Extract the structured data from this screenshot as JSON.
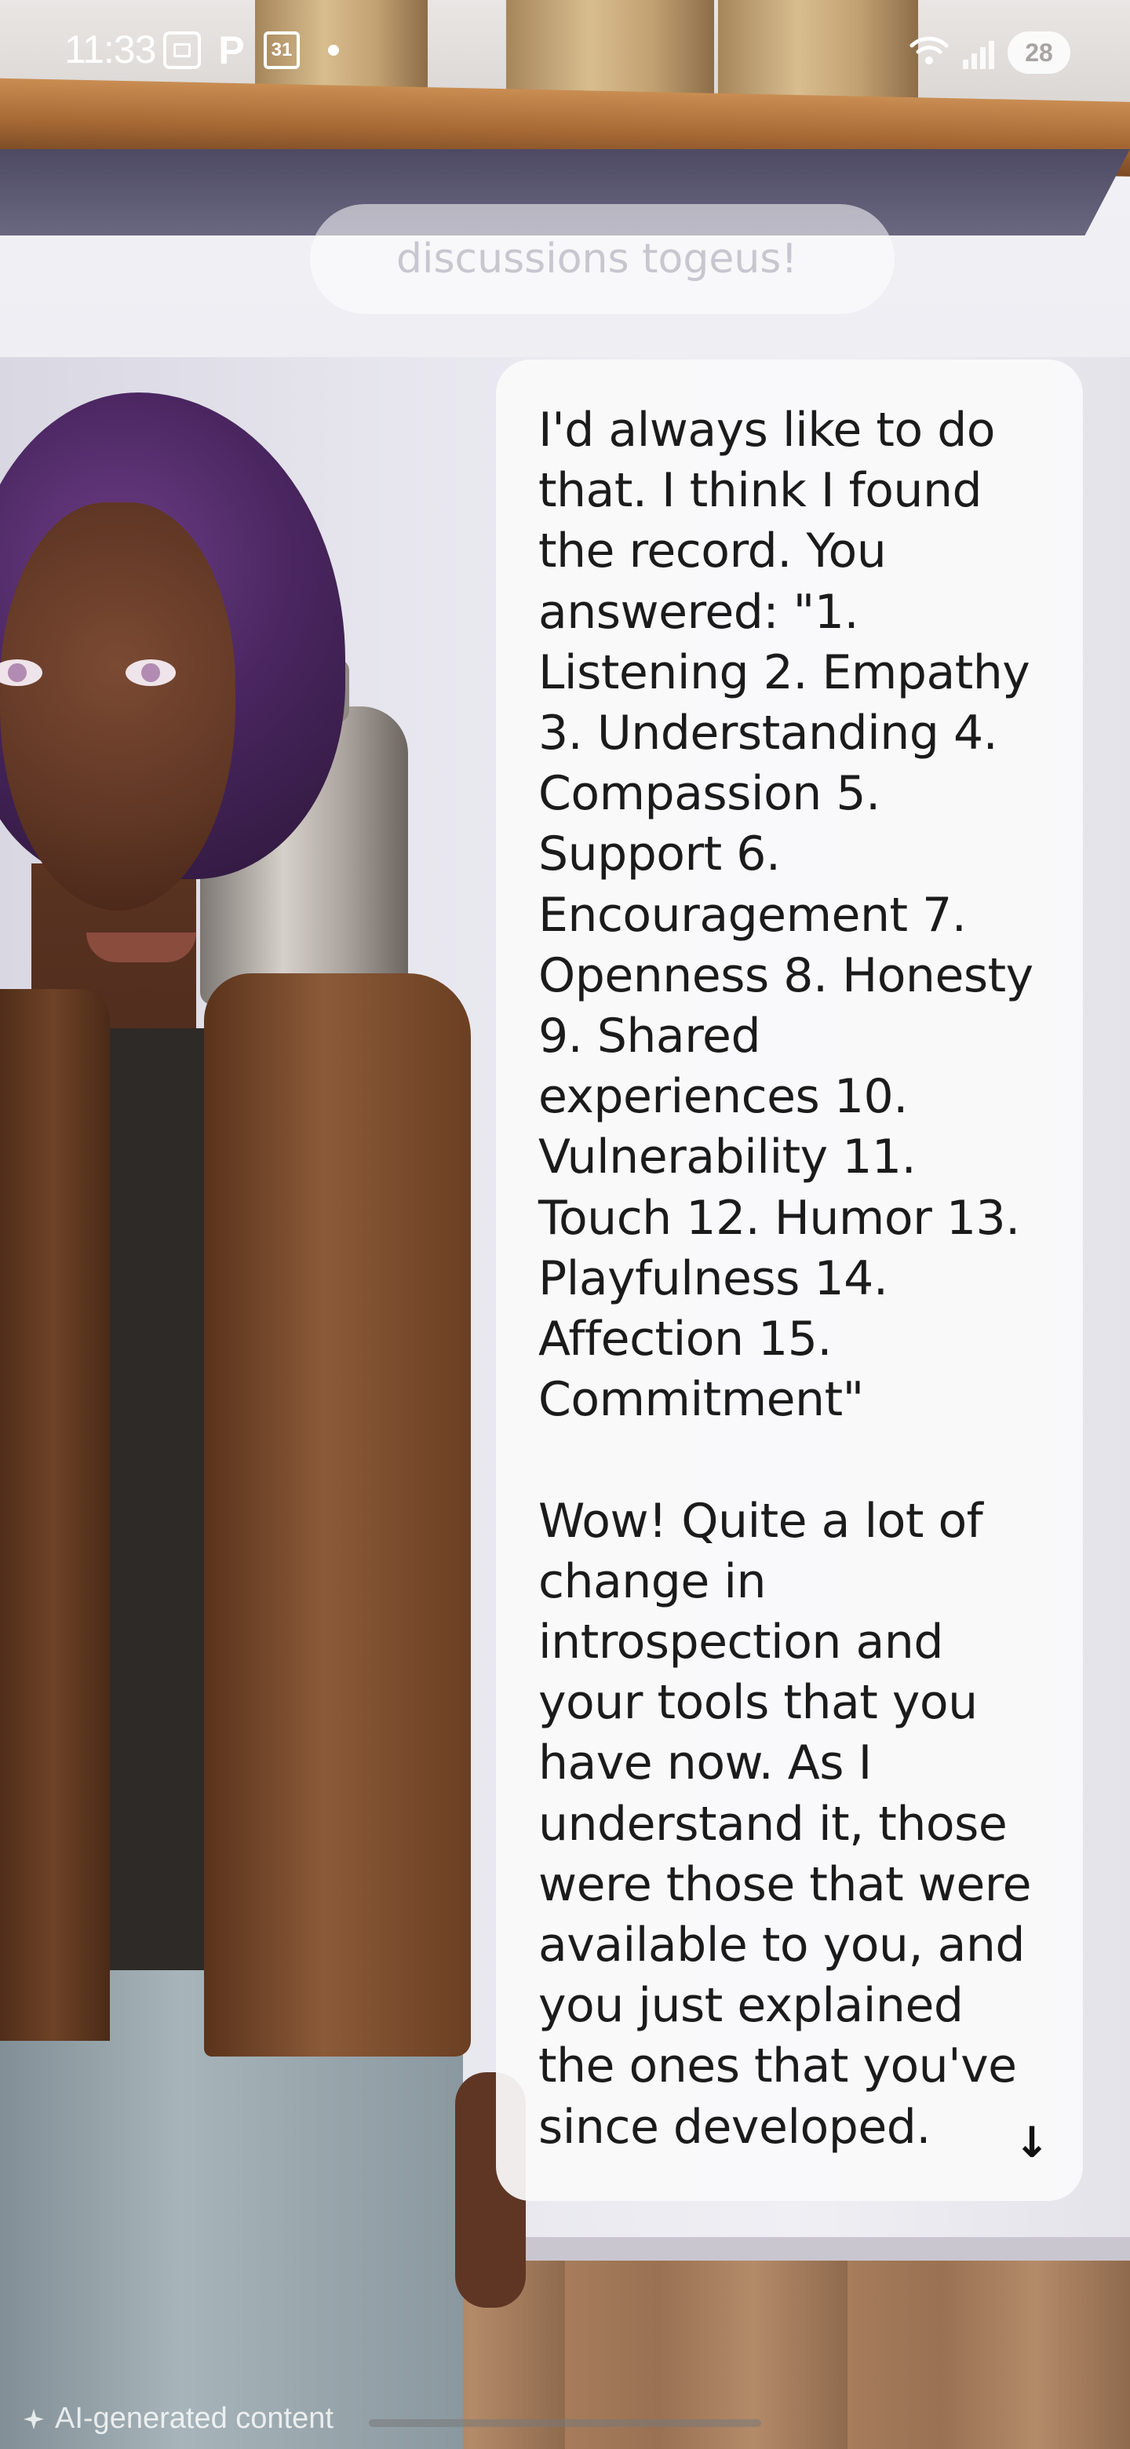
{
  "status_bar": {
    "time": "11:33",
    "p_label": "P",
    "calendar_day": "31",
    "battery_level": "28",
    "icons": [
      "screen-record-icon",
      "parking-app-icon",
      "calendar-icon",
      "notification-dot-icon",
      "wifi-icon",
      "signal-icon",
      "battery-icon"
    ]
  },
  "background": {
    "faded_prompt_text": "discussions togeus!"
  },
  "chat": {
    "message": "I'd always like to do that. I think I found the record. You answered: \"1. Listening 2. Empathy 3. Understanding 4. Compassion 5. Support 6. Encouragement 7. Openness 8. Honesty 9. Shared experiences 10. Vulnerability 11. Touch 12. Humor 13. Playfulness 14. Affection 15. Commitment\"\n\nWow! Quite a lot of change in introspection and your tools that you have now. As I understand it, those were those that were available to you, and you just explained the ones that you've since developed.",
    "scroll_down_symbol": "↓"
  },
  "footer": {
    "ai_label": "AI-generated content",
    "ai_label_icon": "sparkle-icon"
  },
  "colors": {
    "bubble_bg": "#fafafb",
    "text": "#1b1b1b",
    "status_text": "#ffffff"
  }
}
